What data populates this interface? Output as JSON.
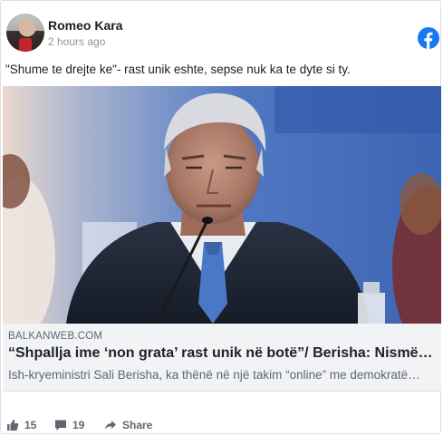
{
  "post": {
    "author": "Romeo Kara",
    "time": "2 hours ago",
    "text": "\"Shume te drejte ke\"- rast unik eshte, sepse nuk ka te dyte si ty."
  },
  "link_preview": {
    "domain": "BALKANWEB.COM",
    "title": "“Shpallja ime ‘non grata’ rast unik në botë”/ Berisha: Nismë…",
    "description": "Ish-kryeministri Sali Berisha, ka thënë në një takim “online” me demokratë…"
  },
  "actions": {
    "likes": "15",
    "comments": "19",
    "share_label": "Share"
  },
  "icons": {
    "platform": "facebook-icon",
    "like": "thumbs-up-icon",
    "comment": "comment-icon",
    "share": "share-icon"
  },
  "colors": {
    "facebook_blue": "#1877f2",
    "link_bg": "#f2f3f5",
    "muted_text": "#606770"
  }
}
